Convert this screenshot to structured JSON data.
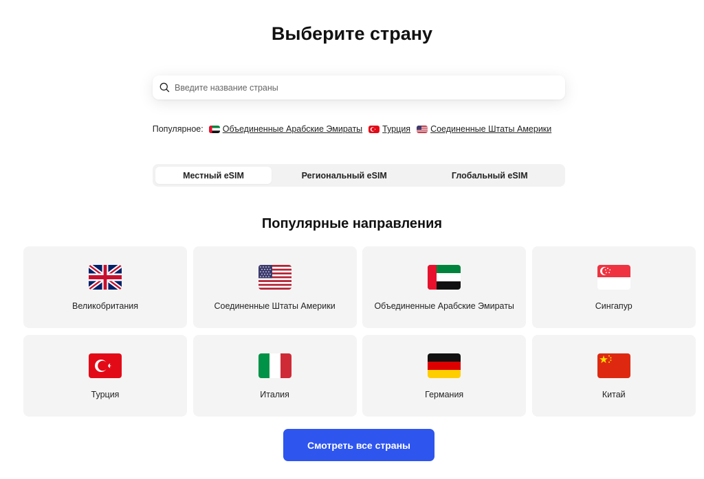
{
  "title": "Выберите страну",
  "search": {
    "placeholder": "Введите название страны",
    "icon": "search-icon"
  },
  "popular": {
    "label": "Популярное:",
    "links": [
      {
        "label": "Объединенные Арабские Эмираты",
        "icon": "uae-flag-icon"
      },
      {
        "label": "Турция",
        "icon": "turkey-flag-icon"
      },
      {
        "label": "Соединенные Штаты Америки",
        "icon": "usa-flag-icon"
      }
    ]
  },
  "tabs": [
    {
      "label": "Местный eSIM",
      "active": true
    },
    {
      "label": "Региональный eSIM",
      "active": false
    },
    {
      "label": "Глобальный eSIM",
      "active": false
    }
  ],
  "section_title": "Популярные направления",
  "destinations": [
    {
      "name": "Великобритания",
      "icon": "uk-flag-icon"
    },
    {
      "name": "Соединенные Штаты Америки",
      "icon": "usa-flag-icon"
    },
    {
      "name": "Объединенные Арабские Эмираты",
      "icon": "uae-flag-icon"
    },
    {
      "name": "Сингапур",
      "icon": "singapore-flag-icon"
    },
    {
      "name": "Турция",
      "icon": "turkey-flag-icon"
    },
    {
      "name": "Италия",
      "icon": "italy-flag-icon"
    },
    {
      "name": "Германия",
      "icon": "germany-flag-icon"
    },
    {
      "name": "Китай",
      "icon": "china-flag-icon"
    }
  ],
  "cta_label": "Смотреть все страны",
  "colors": {
    "accent": "#2E55EE",
    "card_bg": "#F4F4F4",
    "tabs_bg": "#F2F2F2"
  }
}
